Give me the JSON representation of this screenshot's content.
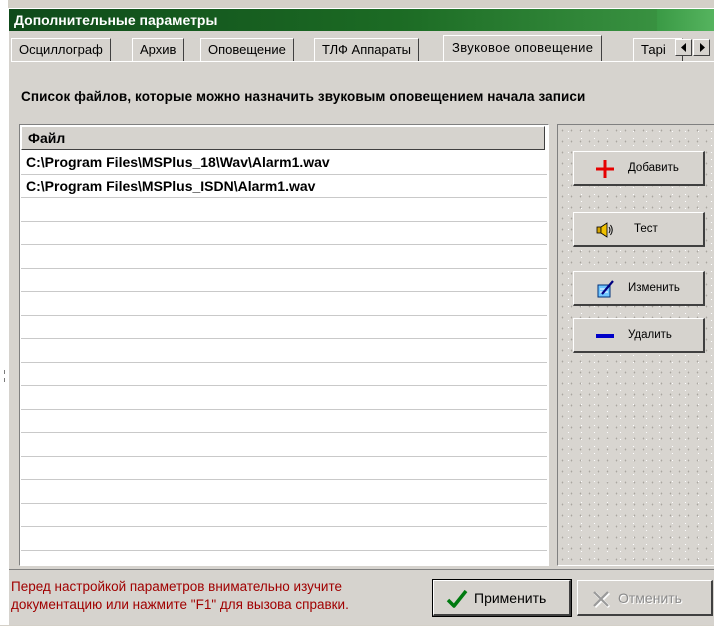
{
  "window": {
    "title": "Дополнительные параметры"
  },
  "tabs": [
    {
      "label": "Осциллограф",
      "active": false
    },
    {
      "label": "Архив",
      "active": false
    },
    {
      "label": "Оповещение",
      "active": false
    },
    {
      "label": "ТЛФ Аппараты",
      "active": false
    },
    {
      "label": "Звуковое оповещение",
      "active": true
    },
    {
      "label": "Тарі",
      "active": false
    }
  ],
  "panel": {
    "heading": "Список файлов, которые можно назначить звуковым оповещением начала записи",
    "list": {
      "column_header": "Файл",
      "rows": [
        "C:\\Program Files\\MSPlus_18\\Wav\\Alarm1.wav",
        "C:\\Program Files\\MSPlus_ISDN\\Alarm1.wav"
      ]
    },
    "buttons": {
      "add": {
        "label": "Добавить",
        "icon": "plus-icon",
        "color": "#e60000"
      },
      "test": {
        "label": "Тест",
        "icon": "speaker-icon"
      },
      "edit": {
        "label": "Изменить",
        "icon": "edit-icon"
      },
      "delete": {
        "label": "Удалить",
        "icon": "minus-icon",
        "color": "#0000c8"
      }
    }
  },
  "footer": {
    "hint_line1": "Перед настройкой параметров внимательно изучите",
    "hint_line2": "документацию или нажмите \"F1\" для вызова справки.",
    "apply_label": "Применить",
    "cancel_label": "Отменить",
    "hint_color": "#a00000"
  }
}
